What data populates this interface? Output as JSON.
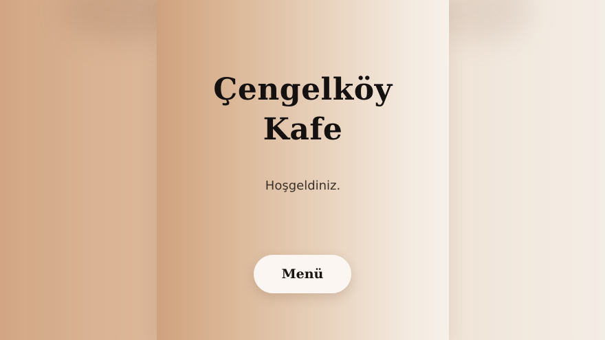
{
  "hero": {
    "title_line1": "Çengelköy",
    "title_line2": "Kafe",
    "subtitle": "Hoşgeldiniz."
  },
  "actions": {
    "menu_label": "Menü"
  },
  "colors": {
    "background_warm": "#d3a785",
    "background_light": "#f5ede4",
    "title_text": "#141110",
    "button_background": "#fbf6f1"
  }
}
